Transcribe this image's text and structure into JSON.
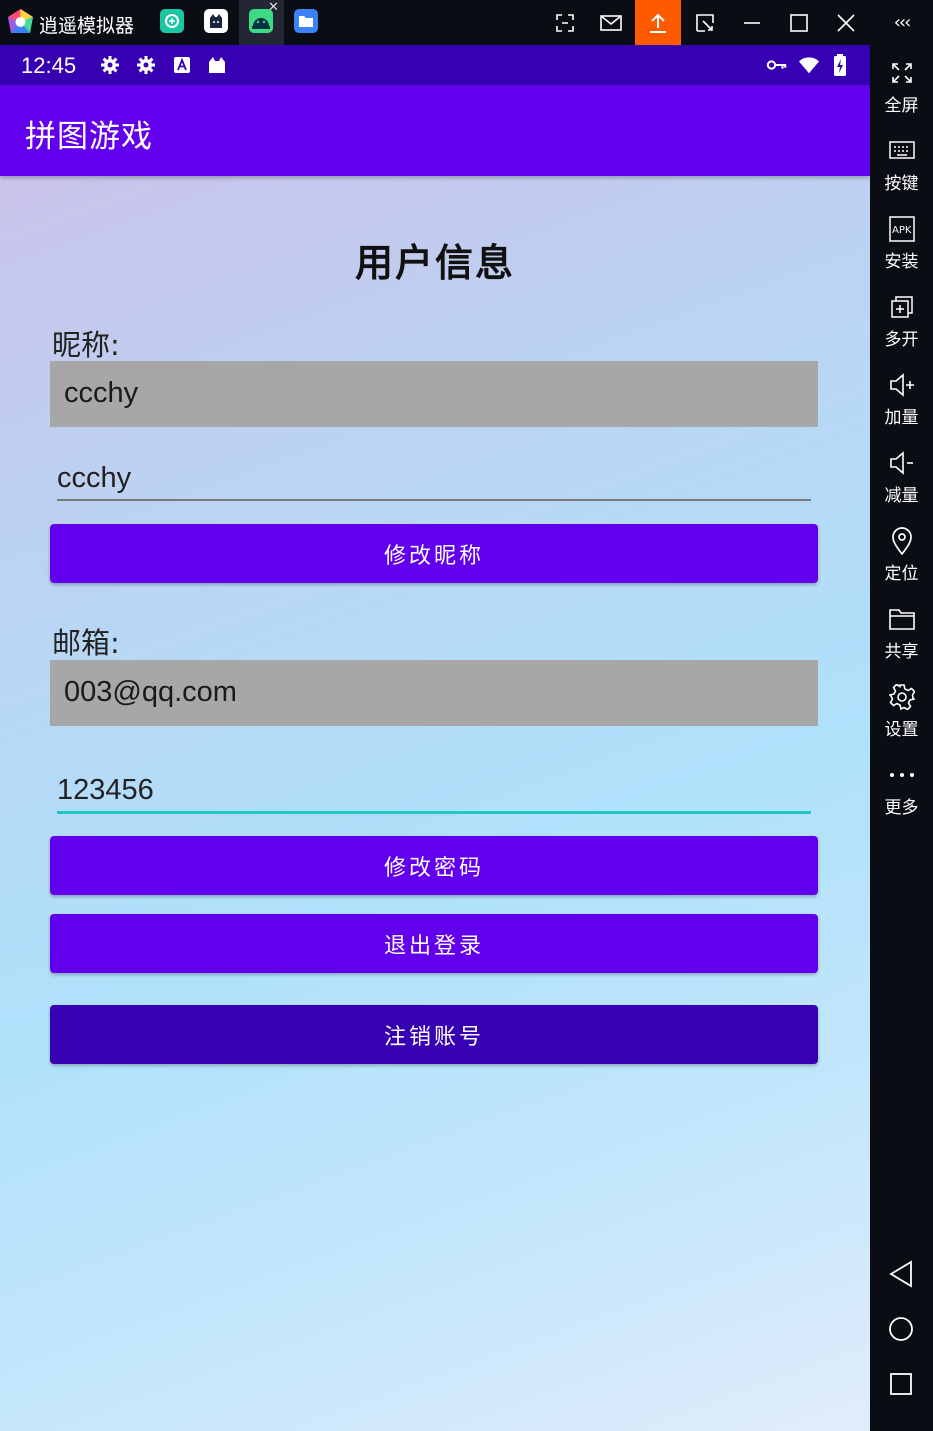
{
  "emulator": {
    "app_name": "逍遥模拟器",
    "tabs": [
      {
        "name": "app-store-tab",
        "color": "#1bc6a3"
      },
      {
        "name": "cat-app-tab",
        "color": "#ffffff"
      },
      {
        "name": "android-app-tab",
        "color": "#3ddc84"
      },
      {
        "name": "files-tab",
        "color": "#3b82f6"
      }
    ],
    "accent": "#ff5a00"
  },
  "status_bar": {
    "time": "12:45"
  },
  "app_bar": {
    "title": "拼图游戏",
    "color": "#6200ee"
  },
  "page": {
    "title": "用户信息",
    "nickname_label": "昵称:",
    "nickname_value": "ccchy",
    "nickname_input": "ccchy",
    "change_nickname_button": "修改昵称",
    "email_label": "邮箱:",
    "email_value": "003@qq.com",
    "password_input": "123456",
    "change_password_button": "修改密码",
    "logout_button": "退出登录",
    "delete_account_button": "注销账号"
  },
  "sidebar": {
    "items": [
      {
        "label": "全屏",
        "icon": "fullscreen-icon"
      },
      {
        "label": "按键",
        "icon": "keyboard-icon"
      },
      {
        "label": "安装",
        "icon": "apk-icon"
      },
      {
        "label": "多开",
        "icon": "multi-instance-icon"
      },
      {
        "label": "加量",
        "icon": "volume-up-icon"
      },
      {
        "label": "减量",
        "icon": "volume-down-icon"
      },
      {
        "label": "定位",
        "icon": "location-icon"
      },
      {
        "label": "共享",
        "icon": "folder-icon"
      },
      {
        "label": "设置",
        "icon": "settings-icon"
      },
      {
        "label": "更多",
        "icon": "more-icon"
      }
    ]
  }
}
